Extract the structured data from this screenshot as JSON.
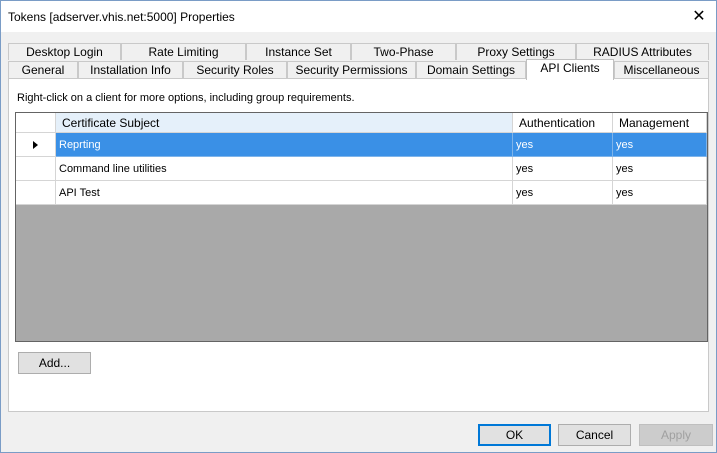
{
  "window": {
    "title": "Tokens [adserver.vhis.net:5000] Properties",
    "close_glyph": "✕"
  },
  "tabs": {
    "row_back": [
      "Desktop Login",
      "Rate Limiting",
      "Instance Set",
      "Two-Phase",
      "Proxy Settings",
      "RADIUS Attributes"
    ],
    "row_front": [
      "General",
      "Installation Info",
      "Security Roles",
      "Security Permissions",
      "Domain Settings",
      "API Clients",
      "Miscellaneous"
    ],
    "active": "API Clients"
  },
  "panel": {
    "hint": "Right-click on a client for more options, including group requirements."
  },
  "grid": {
    "columns": [
      "Certificate Subject",
      "Authentication",
      "Management"
    ],
    "rows": [
      {
        "subject": "Reprting",
        "authentication": "yes",
        "management": "yes",
        "selected": true
      },
      {
        "subject": "Command line utilities",
        "authentication": "yes",
        "management": "yes",
        "selected": false
      },
      {
        "subject": "API Test",
        "authentication": "yes",
        "management": "yes",
        "selected": false
      }
    ]
  },
  "buttons": {
    "add": "Add...",
    "ok": "OK",
    "cancel": "Cancel",
    "apply": "Apply"
  },
  "colors": {
    "selection": "#3a90e6",
    "grid_background": "#a9a9a9",
    "default_button_border": "#0078d7"
  }
}
